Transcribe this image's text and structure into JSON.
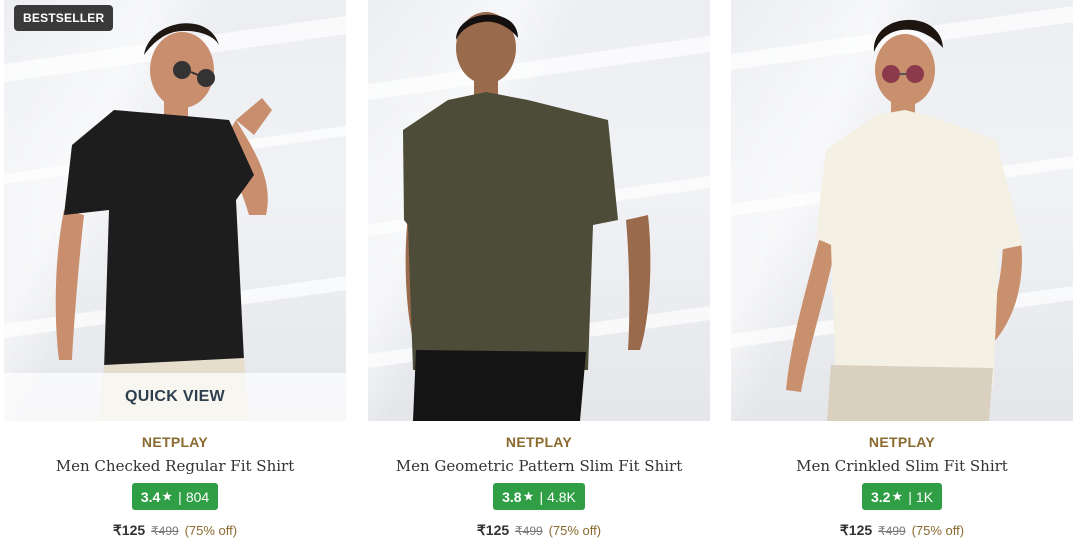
{
  "products": [
    {
      "badge": "BESTSELLER",
      "quick_view": "QUICK VIEW",
      "brand": "NETPLAY",
      "name": "Men Checked Regular Fit Shirt",
      "rating": "3.4",
      "rating_count": "804",
      "price": "₹125",
      "mrp": "₹499",
      "discount": "(75% off)",
      "shirt_color": "#1d1d1d",
      "pants_color": "#e6ddcd",
      "accessory": "sunglasses"
    },
    {
      "brand": "NETPLAY",
      "name": "Men Geometric Pattern Slim Fit Shirt",
      "rating": "3.8",
      "rating_count": "4.8K",
      "price": "₹125",
      "mrp": "₹499",
      "discount": "(75% off)",
      "shirt_color": "#4c4c38",
      "pants_color": "#141414"
    },
    {
      "brand": "NETPLAY",
      "name": "Men Crinkled Slim Fit Shirt",
      "rating": "3.2",
      "rating_count": "1K",
      "price": "₹125",
      "mrp": "₹499",
      "discount": "(75% off)",
      "shirt_color": "#f4f0e4",
      "pants_color": "#d9d0bf",
      "accessory": "sunglasses"
    }
  ],
  "colors": {
    "rating_bg": "#2f9e44",
    "brand": "#8a6a2e",
    "badge_bg": "#3a3a3a"
  },
  "icons": {
    "star": "star-icon"
  }
}
